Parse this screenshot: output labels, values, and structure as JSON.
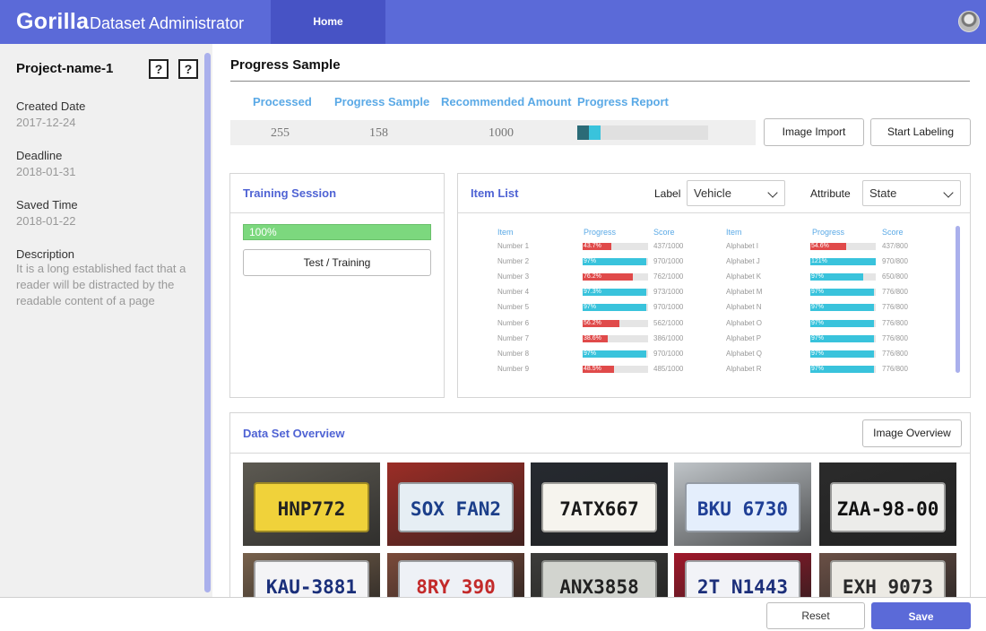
{
  "header": {
    "logo": "Gorilla",
    "app_title": "Dataset Administrator",
    "home_tab": "Home"
  },
  "sidebar": {
    "project_name": "Project-name-1",
    "help_icon_text": "?",
    "created_label": "Created Date",
    "created_value": "2017-12-24",
    "deadline_label": "Deadline",
    "deadline_value": "2018-01-31",
    "saved_label": "Saved Time",
    "saved_value": "2018-01-22",
    "description_label": "Description",
    "description_value": "It is a long established fact that a reader will be distracted by the readable content of a page"
  },
  "progress": {
    "title": "Progress Sample",
    "col_processed": "Processed",
    "col_sample": "Progress Sample",
    "col_recommended": "Recommended Amount",
    "col_report": "Progress Report",
    "processed": "255",
    "sample": "158",
    "recommended": "1000",
    "report_fraction_dark": 0.09,
    "report_fraction_light": 0.09,
    "image_import": "Image Import",
    "start_labeling": "Start Labeling"
  },
  "training": {
    "title": "Training Session",
    "progress_text": "100%",
    "progress": 1.0,
    "button": "Test / Training"
  },
  "item_list": {
    "title": "Item List",
    "label_label": "Label",
    "label_value": "Vehicle",
    "attribute_label": "Attribute",
    "attribute_value": "State",
    "headers": [
      "Item",
      "Progress",
      "Score"
    ],
    "left": [
      {
        "name": "Number  1",
        "pct": 43.7,
        "text": "43.7%",
        "score": "437/1000",
        "color": "#e04a4a"
      },
      {
        "name": "Number  2",
        "pct": 97,
        "text": "97%",
        "score": "970/1000",
        "color": "#39c3dc"
      },
      {
        "name": "Number  3",
        "pct": 76.2,
        "text": "76.2%",
        "score": "762/1000",
        "color": "#e04a4a"
      },
      {
        "name": "Number  4",
        "pct": 97.3,
        "text": "97.3%",
        "score": "973/1000",
        "color": "#39c3dc"
      },
      {
        "name": "Number  5",
        "pct": 97,
        "text": "97%",
        "score": "970/1000",
        "color": "#39c3dc"
      },
      {
        "name": "Number  6",
        "pct": 56.2,
        "text": "56.2%",
        "score": "562/1000",
        "color": "#e04a4a"
      },
      {
        "name": "Number  7",
        "pct": 38.6,
        "text": "38.6%",
        "score": "386/1000",
        "color": "#e04a4a"
      },
      {
        "name": "Number  8",
        "pct": 97,
        "text": "97%",
        "score": "970/1000",
        "color": "#39c3dc"
      },
      {
        "name": "Number  9",
        "pct": 48.5,
        "text": "48.5%",
        "score": "485/1000",
        "color": "#e04a4a"
      }
    ],
    "right": [
      {
        "name": "Alphabet  I",
        "pct": 54.6,
        "text": "54.6%",
        "score": "437/800",
        "color": "#e04a4a"
      },
      {
        "name": "Alphabet  J",
        "pct": 121,
        "text": "121%",
        "score": "970/800",
        "color": "#39c3dc"
      },
      {
        "name": "Alphabet  K",
        "pct": 81,
        "text": "97%",
        "score": "650/800",
        "color": "#39c3dc"
      },
      {
        "name": "Alphabet  M",
        "pct": 97,
        "text": "97%",
        "score": "776/800",
        "color": "#39c3dc"
      },
      {
        "name": "Alphabet  N",
        "pct": 97,
        "text": "97%",
        "score": "776/800",
        "color": "#39c3dc"
      },
      {
        "name": "Alphabet  O",
        "pct": 97,
        "text": "97%",
        "score": "776/800",
        "color": "#39c3dc"
      },
      {
        "name": "Alphabet  P",
        "pct": 97,
        "text": "97%",
        "score": "776/800",
        "color": "#39c3dc"
      },
      {
        "name": "Alphabet  Q",
        "pct": 97,
        "text": "97%",
        "score": "776/800",
        "color": "#39c3dc"
      },
      {
        "name": "Alphabet  R",
        "pct": 97,
        "text": "97%",
        "score": "776/800",
        "color": "#39c3dc"
      }
    ]
  },
  "overview": {
    "title": "Data Set Overview",
    "button": "Image Overview",
    "plates": [
      {
        "text": "HNP772",
        "bg": "#f0d23a",
        "fg": "#222",
        "photo": "#5d5a52"
      },
      {
        "text": "SOX FAN2",
        "bg": "#e6eef4",
        "fg": "#1c3f8a",
        "photo": "#9b2d26"
      },
      {
        "text": "7ATX667",
        "bg": "#f6f4ee",
        "fg": "#1a1a1a",
        "photo": "#262a30"
      },
      {
        "text": "BKU 6730",
        "bg": "#e4eefc",
        "fg": "#1f3f96",
        "photo": "#bfc4c8"
      },
      {
        "text": "ZAA-98-00",
        "bg": "#ececea",
        "fg": "#111",
        "photo": "#2b2b2b"
      },
      {
        "text": "KAU-3881",
        "bg": "#f4f4f6",
        "fg": "#1a2f7a",
        "photo": "#77614c"
      },
      {
        "text": "8RY 390",
        "bg": "#eef1f6",
        "fg": "#c32a2a",
        "photo": "#7a4a3a"
      },
      {
        "text": "ANX3858",
        "bg": "#d2d4cf",
        "fg": "#222",
        "photo": "#3c3c3a"
      },
      {
        "text": "2T N1443",
        "bg": "#f2f3f7",
        "fg": "#1c2f7a",
        "photo": "#a0182a"
      },
      {
        "text": "EXH 9073",
        "bg": "#eceae4",
        "fg": "#2a2a2a",
        "photo": "#6a5046"
      }
    ]
  },
  "footer": {
    "reset": "Reset",
    "save": "Save"
  },
  "colors": {
    "brand": "#5b6ad8",
    "accent_text": "#4f63d4",
    "stat_head": "#5aa9e6"
  }
}
